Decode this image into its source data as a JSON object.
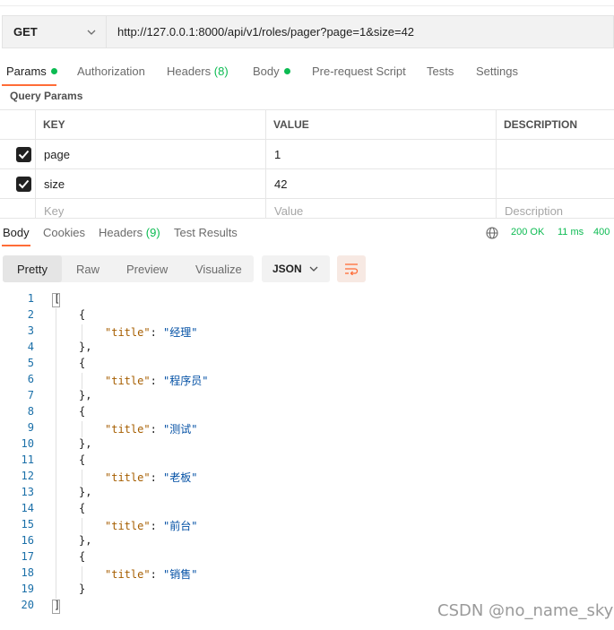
{
  "request": {
    "method": "GET",
    "url": "http://127.0.0.1:8000/api/v1/roles/pager?page=1&size=42"
  },
  "request_tabs": {
    "params": "Params",
    "authorization": "Authorization",
    "headers": "Headers",
    "headers_count": "(8)",
    "body": "Body",
    "prerequest": "Pre-request Script",
    "tests": "Tests",
    "settings": "Settings"
  },
  "query_params": {
    "section_label": "Query Params",
    "columns": [
      "KEY",
      "VALUE",
      "DESCRIPTION"
    ],
    "rows": [
      {
        "key": "page",
        "value": "1",
        "description": "",
        "checked": true
      },
      {
        "key": "size",
        "value": "42",
        "description": "",
        "checked": true
      }
    ],
    "placeholders": {
      "key": "Key",
      "value": "Value",
      "description": "Description"
    }
  },
  "response_tabs": {
    "body": "Body",
    "cookies": "Cookies",
    "headers": "Headers",
    "headers_count": "(9)",
    "test_results": "Test Results"
  },
  "response_meta": {
    "status": "200 OK",
    "time": "11 ms",
    "size": "400"
  },
  "view_modes": {
    "pretty": "Pretty",
    "raw": "Raw",
    "preview": "Preview",
    "visualize": "Visualize",
    "format": "JSON"
  },
  "response_body": {
    "line_numbers": [
      "1",
      "2",
      "3",
      "4",
      "5",
      "6",
      "7",
      "8",
      "9",
      "10",
      "11",
      "12",
      "13",
      "14",
      "15",
      "16",
      "17",
      "18",
      "19",
      "20"
    ],
    "open_bracket": "[",
    "close_bracket": "]",
    "open_brace": "{",
    "close_brace_comma": "},",
    "close_brace": "}",
    "key": "\"title\"",
    "separator": ": ",
    "titles": [
      "\"经理\"",
      "\"程序员\"",
      "\"测试\"",
      "\"老板\"",
      "\"前台\"",
      "\"销售\""
    ]
  },
  "watermark": "CSDN @no_name_sky",
  "colors": {
    "accent": "#ff6c37",
    "success": "#0cbb52",
    "json_key": "#a65e00",
    "json_string": "#0451a5",
    "line_number": "#1a6fa8"
  }
}
